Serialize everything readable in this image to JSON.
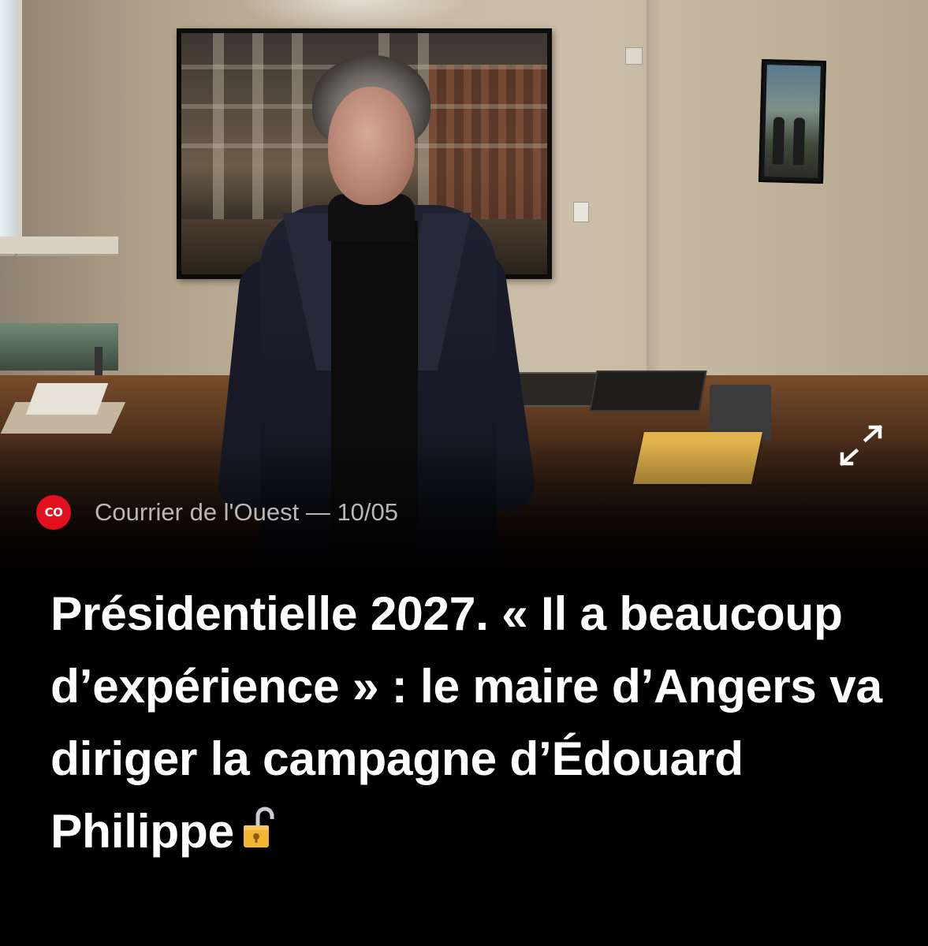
{
  "article": {
    "source_badge": "CO",
    "source_name": "Courrier de l'Ouest",
    "source_separator": "—",
    "date": "10/05",
    "headline": "Présidentielle 2027. « Il a beaucoup d’expérience » : le maire d’Angers va diriger la campagne d’Édouard Philippe",
    "headline_icon": "unlocked-padlock-icon",
    "image_action_icon": "expand-arrows-icon"
  },
  "colors": {
    "background": "#000000",
    "headline_text": "#ffffff",
    "source_text": "#b9b7b4",
    "badge": "#e3101d",
    "lock": "#f2b534"
  }
}
